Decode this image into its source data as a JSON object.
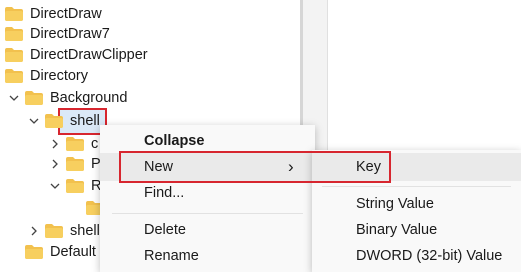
{
  "tree": {
    "items": [
      {
        "label": "DirectDraw"
      },
      {
        "label": "DirectDraw7"
      },
      {
        "label": "DirectDrawClipper"
      },
      {
        "label": "Directory"
      },
      {
        "label": "Background"
      },
      {
        "label": "shell"
      },
      {
        "label": "c"
      },
      {
        "label": "P"
      },
      {
        "label": "R"
      },
      {
        "label": ""
      },
      {
        "label": "shell"
      },
      {
        "label": "Default"
      }
    ]
  },
  "context_menu": {
    "collapse": "Collapse",
    "new": "New",
    "new_arrow": "›",
    "find": "Find...",
    "delete": "Delete",
    "rename": "Rename"
  },
  "submenu": {
    "key": "Key",
    "string_value": "String Value",
    "binary_value": "Binary Value",
    "dword_value": "DWORD (32-bit) Value"
  },
  "colors": {
    "folder": "#f2c14e",
    "highlight_border": "#d7262f",
    "selection": "#dbe9f7"
  }
}
